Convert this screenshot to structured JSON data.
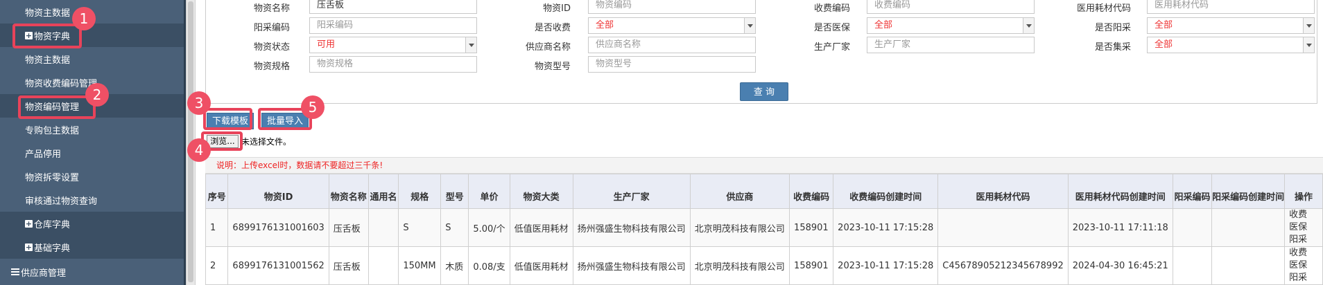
{
  "sidebar": {
    "items": [
      {
        "label": "物资主数据"
      },
      {
        "label": "物资字典"
      },
      {
        "label": "物资主数据"
      },
      {
        "label": "物资收费编码管理"
      },
      {
        "label": "物资编码管理"
      },
      {
        "label": "专购包主数据"
      },
      {
        "label": "产品停用"
      },
      {
        "label": "物资拆零设置"
      },
      {
        "label": "审核通过物资查询"
      },
      {
        "label": "仓库字典"
      },
      {
        "label": "基础字典"
      },
      {
        "label": "供应商管理"
      }
    ]
  },
  "callouts": [
    "1",
    "2",
    "3",
    "4",
    "5"
  ],
  "filters": {
    "material_name": {
      "label": "物资名称",
      "value": "压舌板"
    },
    "material_id": {
      "label": "物资ID",
      "placeholder": "物资编码"
    },
    "charge_code": {
      "label": "收费编码",
      "placeholder": "收费编码"
    },
    "medical_code": {
      "label": "医用耗材代码",
      "placeholder": "医用耗材代码"
    },
    "sunshine_code": {
      "label": "阳采编码",
      "placeholder": "阳采编码"
    },
    "is_charged": {
      "label": "是否收费",
      "value": "全部"
    },
    "is_insured": {
      "label": "是否医保",
      "value": "全部"
    },
    "is_sunshine": {
      "label": "是否阳采",
      "value": "全部"
    },
    "status": {
      "label": "物资状态",
      "value": "可用"
    },
    "supplier": {
      "label": "供应商名称",
      "placeholder": "供应商名称"
    },
    "manufacturer": {
      "label": "生产厂家",
      "placeholder": "生产厂家"
    },
    "is_central": {
      "label": "是否集采",
      "value": "全部"
    },
    "spec": {
      "label": "物资规格",
      "placeholder": "物资规格"
    },
    "model": {
      "label": "物资型号",
      "placeholder": "物资型号"
    }
  },
  "query_label": "查 询",
  "download_template_label": "下载模板",
  "batch_import_label": "批量导入",
  "browse_label": "浏览...",
  "no_file_text": "未选择文件。",
  "note_text": "说明：上传excel时，数据请不要超过三千条!",
  "table": {
    "headers": [
      "序号",
      "物资ID",
      "物资名称",
      "通用名",
      "规格",
      "型号",
      "单价",
      "物资大类",
      "生产厂家",
      "供应商",
      "收费编码",
      "收费编码创建时间",
      "医用耗材代码",
      "医用耗材代码创建时间",
      "阳采编码",
      "阳采编码创建时间",
      "操作"
    ],
    "rows": [
      [
        "1",
        "6899176131001603",
        "压舌板",
        "",
        "S",
        "S",
        "5.00/个",
        "低值医用耗材",
        "扬州强盛生物科技有限公司",
        "北京明茂科技有限公司",
        "158901",
        "2023-10-11 17:15:28",
        "",
        "2023-10-11 17:11:18",
        "",
        "",
        "收费 医保 阳采"
      ],
      [
        "2",
        "6899176131001562",
        "压舌板",
        "",
        "150MM",
        "木质",
        "0.08/支",
        "低值医用耗材",
        "扬州强盛生物科技有限公司",
        "北京明茂科技有限公司",
        "158901",
        "2023-10-11 17:15:28",
        "C45678905212345678992",
        "2024-04-30 16:45:21",
        "",
        "",
        "收费 医保 阳采"
      ]
    ]
  },
  "colors": {
    "sidebar_bg": "#4a6078",
    "accent_blue": "#4a7fb0",
    "callout_red": "#e8435a",
    "note_red": "#e22"
  }
}
